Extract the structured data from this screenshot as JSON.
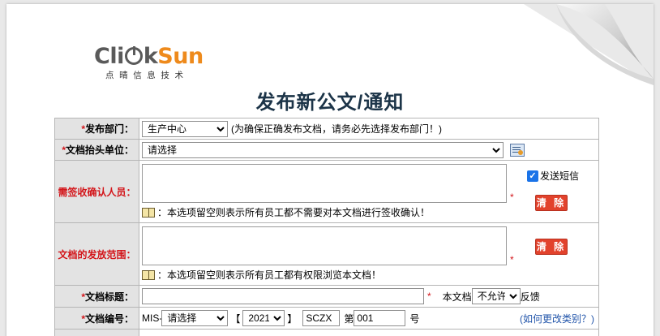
{
  "logo": {
    "click": "Cli",
    "k": "k",
    "sun": "Sun",
    "tagline": "点晴信息技术"
  },
  "page_title": "发布新公文/通知",
  "form": {
    "dept": {
      "label": "发布部门：",
      "selected": "生产中心",
      "note": "(为确保正确发布文档，请务必先选择发布部门！)"
    },
    "unit": {
      "label": "文档抬头单位：",
      "selected": "请选择"
    },
    "signers": {
      "label": "需签收确认人员：",
      "hint": "：本选项留空则表示所有员工都不需要对本文档进行签收确认！",
      "sms_label": "发送短信",
      "clear": "清 除"
    },
    "scope": {
      "label": "文档的发放范围：",
      "hint": "：本选项留空则表示所有员工都有权限浏览本文档！",
      "clear": "清 除"
    },
    "doc_title": {
      "label": "文档标题：",
      "feedback_prefix": "本文档",
      "feedback_selected": "不允许",
      "feedback_suffix": "反馈"
    },
    "doc_no": {
      "label": "文档编号：",
      "prefix": "MIS-",
      "type_selected": "请选择",
      "open_bracket": "【",
      "year_selected": "2021",
      "close_bracket": "】",
      "code": "SCZX",
      "di": "第",
      "number": "001",
      "hao": "号",
      "help_link": "(如何更改类别？)"
    }
  }
}
